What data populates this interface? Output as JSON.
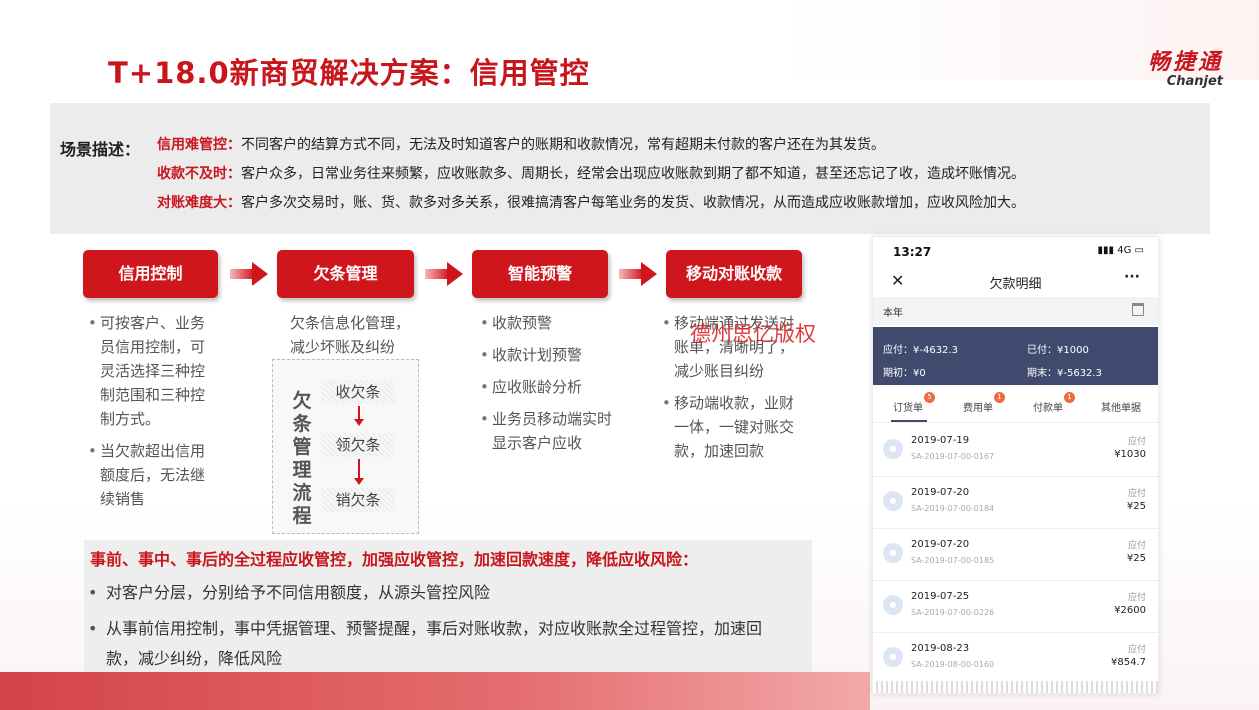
{
  "title": "T+18.0新商贸解决方案：信用管控",
  "logo": {
    "cn": "畅捷通",
    "en": "Chanjet"
  },
  "scene": {
    "label": "场景描述：",
    "lines": [
      {
        "key": "信用难管控：",
        "text": "不同客户的结算方式不同，无法及时知道客户的账期和收款情况，常有超期未付款的客户还在为其发货。"
      },
      {
        "key": "收款不及时：",
        "text": "客户众多，日常业务往来频繁，应收账款多、周期长，经常会出现应收账款到期了都不知道，甚至还忘记了收，造成坏账情况。"
      },
      {
        "key": "对账难度大：",
        "text": "客户多次交易时，账、货、款多对多关系，很难搞清客户每笔业务的发货、收款情况，从而造成应收账款增加，应收风险加大。"
      }
    ]
  },
  "steps": [
    "信用控制",
    "欠条管理",
    "智能预警",
    "移动对账收款"
  ],
  "col1": [
    "可按客户、业务员信用控制，可灵活选择三种控制范围和三种控制方式。",
    "当欠款超出信用额度后，无法继续销售"
  ],
  "col2": {
    "intro": "欠条信息化管理，减少坏账及纠纷",
    "flow_title": "欠条管理流程",
    "flow": [
      "收欠条",
      "领欠条",
      "销欠条"
    ]
  },
  "col3": [
    "收款预警",
    "收款计划预警",
    "应收账龄分析",
    "业务员移动端实时显示客户应收"
  ],
  "col4": [
    "移动端通过发送对账单，清晰明了，减少账目纠纷",
    "移动端收款，业财一体，一键对账交款，加速回款"
  ],
  "watermark": "德州思亿版权",
  "summary": {
    "heading": "事前、事中、事后的全过程应收管控，加强应收管控，加速回款速度，降低应收风险：",
    "bullets": [
      "对客户分层，分别给予不同信用额度，从源头管控风险",
      "从事前信用控制，事中凭据管理、预警提醒，事后对账收款，对应收账款全过程管控，加速回款，减少纠纷，降低风险"
    ]
  },
  "phone": {
    "time": "13:27",
    "signal": "4G",
    "title": "欠款明细",
    "period": "本年",
    "card": {
      "yingfu": "应付：¥-4632.3",
      "yifu": "已付：¥1000",
      "qichu": "期初：¥0",
      "qimo": "期末：¥-5632.3"
    },
    "tabs": [
      {
        "label": "订货单",
        "badge": "5"
      },
      {
        "label": "费用单",
        "badge": "1"
      },
      {
        "label": "付款单",
        "badge": "1"
      },
      {
        "label": "其他单据",
        "badge": ""
      }
    ],
    "rows": [
      {
        "date": "2019-07-19",
        "code": "SA-2019-07-00-0167",
        "label": "应付",
        "value": "¥1030"
      },
      {
        "date": "2019-07-20",
        "code": "SA-2019-07-00-0184",
        "label": "应付",
        "value": "¥25"
      },
      {
        "date": "2019-07-20",
        "code": "SA-2019-07-00-0185",
        "label": "应付",
        "value": "¥25"
      },
      {
        "date": "2019-07-25",
        "code": "SA-2019-07-00-0226",
        "label": "应付",
        "value": "¥2600"
      },
      {
        "date": "2019-08-23",
        "code": "SA-2019-08-00-0160",
        "label": "应付",
        "value": "¥854.7"
      }
    ]
  }
}
